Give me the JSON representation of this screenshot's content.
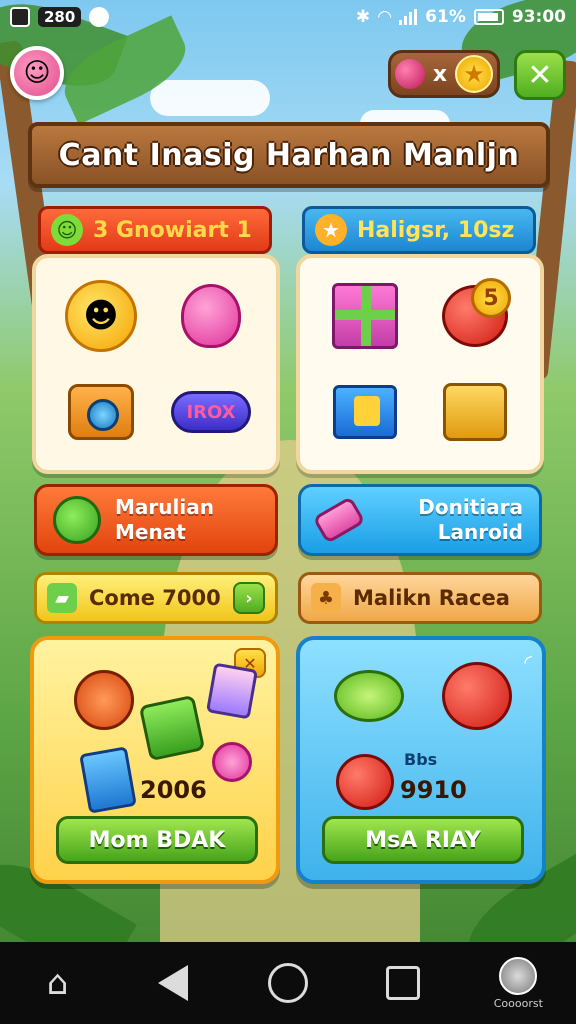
{
  "status_bar": {
    "left_box": "280",
    "battery_pct": "61%",
    "time": "93:00"
  },
  "header": {
    "currency_multiplier": "x",
    "close_icon": "x-icon"
  },
  "title": "Cant Inasig Harhan Manljn",
  "tabs": {
    "left": {
      "label": "3 Gnowiart 1",
      "icon": "smiley-icon"
    },
    "right": {
      "label": "Haligsr, 10sz",
      "icon": "star-icon"
    }
  },
  "cards": {
    "left_items": [
      "sun-creature-icon",
      "pink-blob-icon",
      "camera-icon",
      "badge-item-icon"
    ],
    "left_badge_text": "IROX",
    "right_items": [
      "gift-icon",
      "apple-icon",
      "blue-box-icon",
      "gold-chest-icon"
    ],
    "apple_coin": "5"
  },
  "buttons": {
    "left": {
      "line1": "Marulian",
      "line2": "Menat"
    },
    "right": {
      "line1": "Donitiara",
      "line2": "Lanroid"
    }
  },
  "pills": {
    "left": "Come 7000",
    "right": "Malikn Racea"
  },
  "offers": {
    "left": {
      "value": "2006",
      "button": "Mom BDAK"
    },
    "right": {
      "small": "Bbs",
      "value": "9910",
      "button": "MsA RIAY"
    }
  },
  "nav": {
    "profile_label": "Coooorst"
  },
  "colors": {
    "accent_green": "#4fae20",
    "accent_orange": "#e2440e",
    "accent_blue": "#1a9ee6",
    "wood": "#8a5226"
  }
}
